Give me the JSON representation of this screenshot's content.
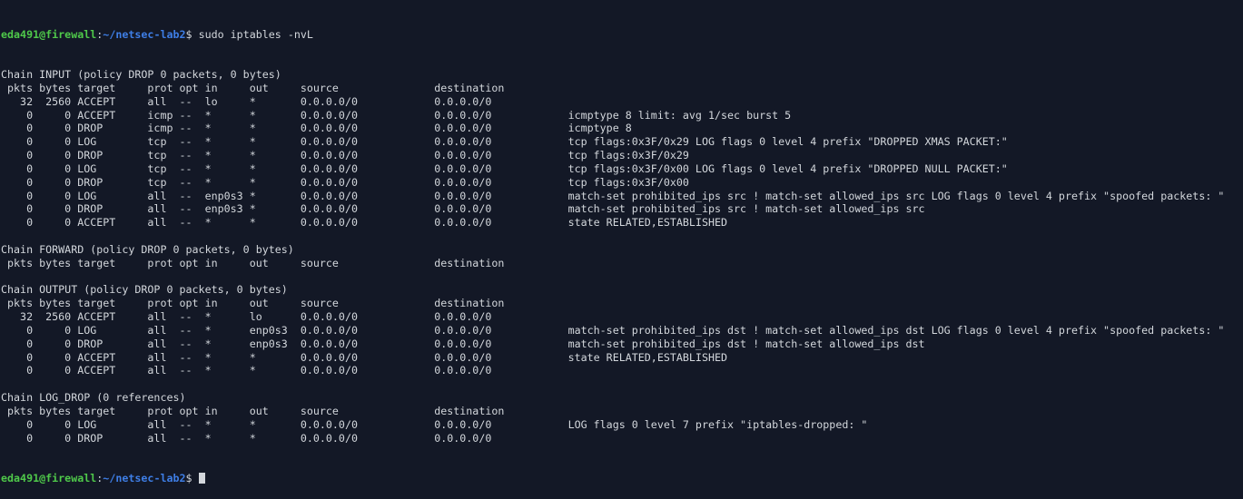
{
  "colors": {
    "background": "#131826",
    "text": "#d3d7dc",
    "user_host": "#4fc94a",
    "path": "#3e7ee6"
  },
  "prompt": {
    "user_host": "eda491@firewall",
    "separator": ":",
    "path": "~/netsec-lab2",
    "symbol": "$ ",
    "command": "sudo iptables -nvL"
  },
  "header": " pkts bytes target     prot opt in     out     source               destination",
  "chains": [
    {
      "title": "Chain INPUT (policy DROP 0 packets, 0 bytes)",
      "rows": [
        [
          "32",
          "2560",
          "ACCEPT",
          "all",
          "--",
          "lo",
          "*",
          "0.0.0.0/0",
          "0.0.0.0/0",
          ""
        ],
        [
          "0",
          "0",
          "ACCEPT",
          "icmp",
          "--",
          "*",
          "*",
          "0.0.0.0/0",
          "0.0.0.0/0",
          "icmptype 8 limit: avg 1/sec burst 5"
        ],
        [
          "0",
          "0",
          "DROP",
          "icmp",
          "--",
          "*",
          "*",
          "0.0.0.0/0",
          "0.0.0.0/0",
          "icmptype 8"
        ],
        [
          "0",
          "0",
          "LOG",
          "tcp",
          "--",
          "*",
          "*",
          "0.0.0.0/0",
          "0.0.0.0/0",
          "tcp flags:0x3F/0x29 LOG flags 0 level 4 prefix \"DROPPED XMAS PACKET:\""
        ],
        [
          "0",
          "0",
          "DROP",
          "tcp",
          "--",
          "*",
          "*",
          "0.0.0.0/0",
          "0.0.0.0/0",
          "tcp flags:0x3F/0x29"
        ],
        [
          "0",
          "0",
          "LOG",
          "tcp",
          "--",
          "*",
          "*",
          "0.0.0.0/0",
          "0.0.0.0/0",
          "tcp flags:0x3F/0x00 LOG flags 0 level 4 prefix \"DROPPED NULL PACKET:\""
        ],
        [
          "0",
          "0",
          "DROP",
          "tcp",
          "--",
          "*",
          "*",
          "0.0.0.0/0",
          "0.0.0.0/0",
          "tcp flags:0x3F/0x00"
        ],
        [
          "0",
          "0",
          "LOG",
          "all",
          "--",
          "enp0s3",
          "*",
          "0.0.0.0/0",
          "0.0.0.0/0",
          "match-set prohibited_ips src ! match-set allowed_ips src LOG flags 0 level 4 prefix \"spoofed packets: \""
        ],
        [
          "0",
          "0",
          "DROP",
          "all",
          "--",
          "enp0s3",
          "*",
          "0.0.0.0/0",
          "0.0.0.0/0",
          "match-set prohibited_ips src ! match-set allowed_ips src"
        ],
        [
          "0",
          "0",
          "ACCEPT",
          "all",
          "--",
          "*",
          "*",
          "0.0.0.0/0",
          "0.0.0.0/0",
          "state RELATED,ESTABLISHED"
        ]
      ]
    },
    {
      "title": "Chain FORWARD (policy DROP 0 packets, 0 bytes)",
      "rows": []
    },
    {
      "title": "Chain OUTPUT (policy DROP 0 packets, 0 bytes)",
      "rows": [
        [
          "32",
          "2560",
          "ACCEPT",
          "all",
          "--",
          "*",
          "lo",
          "0.0.0.0/0",
          "0.0.0.0/0",
          ""
        ],
        [
          "0",
          "0",
          "LOG",
          "all",
          "--",
          "*",
          "enp0s3",
          "0.0.0.0/0",
          "0.0.0.0/0",
          "match-set prohibited_ips dst ! match-set allowed_ips dst LOG flags 0 level 4 prefix \"spoofed packets: \""
        ],
        [
          "0",
          "0",
          "DROP",
          "all",
          "--",
          "*",
          "enp0s3",
          "0.0.0.0/0",
          "0.0.0.0/0",
          "match-set prohibited_ips dst ! match-set allowed_ips dst"
        ],
        [
          "0",
          "0",
          "ACCEPT",
          "all",
          "--",
          "*",
          "*",
          "0.0.0.0/0",
          "0.0.0.0/0",
          "state RELATED,ESTABLISHED"
        ],
        [
          "0",
          "0",
          "ACCEPT",
          "all",
          "--",
          "*",
          "*",
          "0.0.0.0/0",
          "0.0.0.0/0",
          ""
        ]
      ]
    },
    {
      "title": "Chain LOG_DROP (0 references)",
      "rows": [
        [
          "0",
          "0",
          "LOG",
          "all",
          "--",
          "*",
          "*",
          "0.0.0.0/0",
          "0.0.0.0/0",
          "LOG flags 0 level 7 prefix \"iptables-dropped: \""
        ],
        [
          "0",
          "0",
          "DROP",
          "all",
          "--",
          "*",
          "*",
          "0.0.0.0/0",
          "0.0.0.0/0",
          ""
        ]
      ]
    }
  ]
}
